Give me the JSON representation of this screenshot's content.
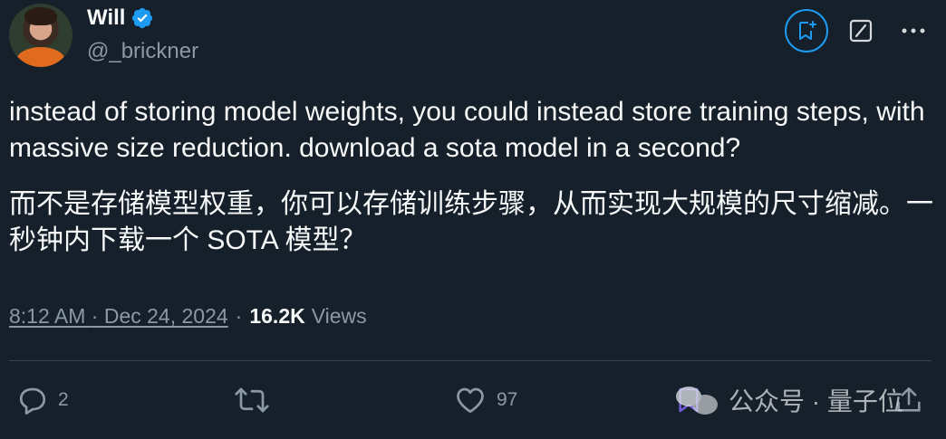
{
  "user": {
    "display_name": "Will",
    "handle": "@_brickner",
    "avatar_icon": "avatar-photo",
    "verified_color": "#1d9bf0"
  },
  "top_actions": {
    "grok_bookmark_icon": "bookmark-sparkle-icon",
    "edit_icon": "edit-icon",
    "more_icon": "more-icon"
  },
  "tweet": {
    "text_en": "instead of storing model weights, you could instead store training steps, with massive size reduction. download a sota model in a second?",
    "text_zh": "而不是存储模型权重，你可以存储训练步骤，从而实现大规模的尺寸缩减。一秒钟内下载一个 SOTA 模型？"
  },
  "meta": {
    "time": "8:12 AM",
    "separator": "·",
    "date": "Dec 24, 2024",
    "views_count": "16.2K",
    "views_label": "Views"
  },
  "actions": {
    "reply_count": "2",
    "retweet_count": "",
    "like_count": "97"
  },
  "watermark": {
    "text": "公众号 · 量子位"
  },
  "colors": {
    "background": "#15202b",
    "text": "#f7f9f9",
    "muted": "#8b98a5",
    "accent": "#1d9bf0",
    "divider": "#38444d"
  }
}
